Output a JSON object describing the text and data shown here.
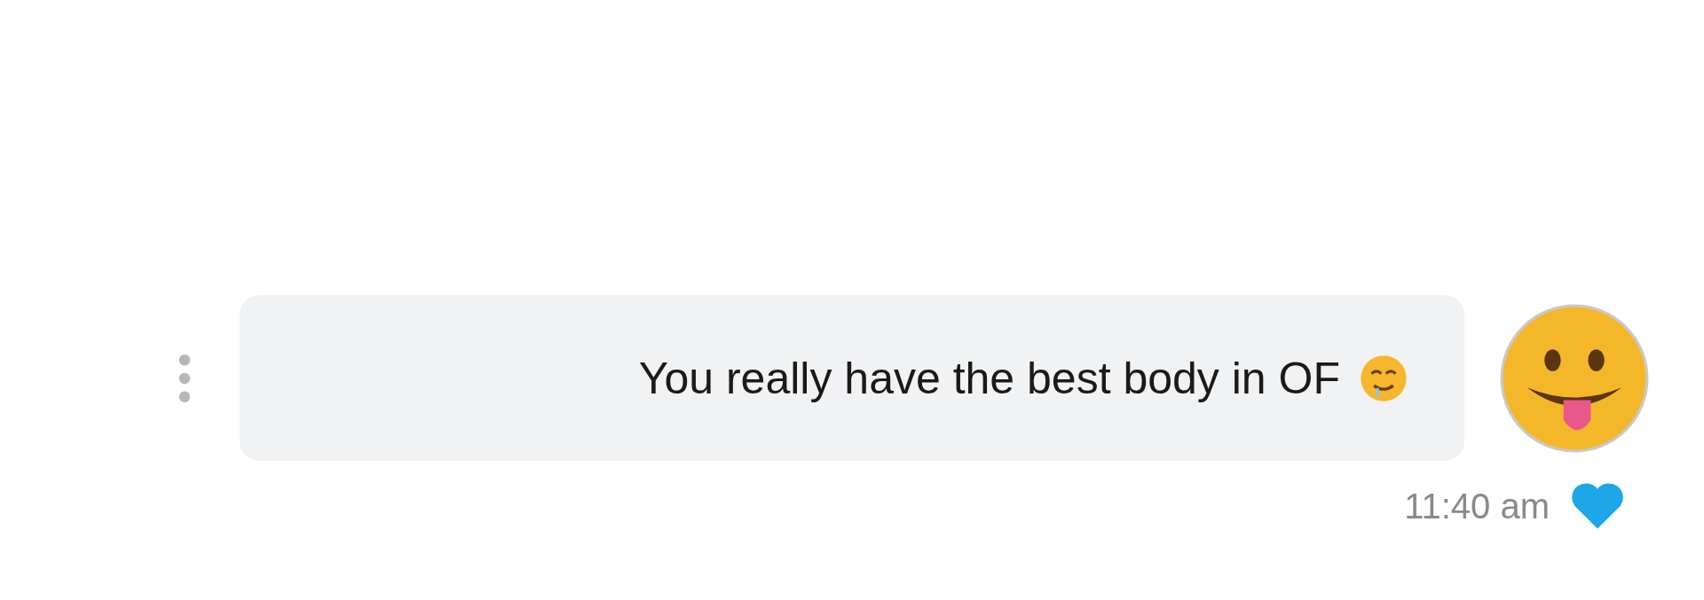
{
  "message": {
    "text": "You really have the best body in OF",
    "time": "11:40 am",
    "liked": true
  }
}
